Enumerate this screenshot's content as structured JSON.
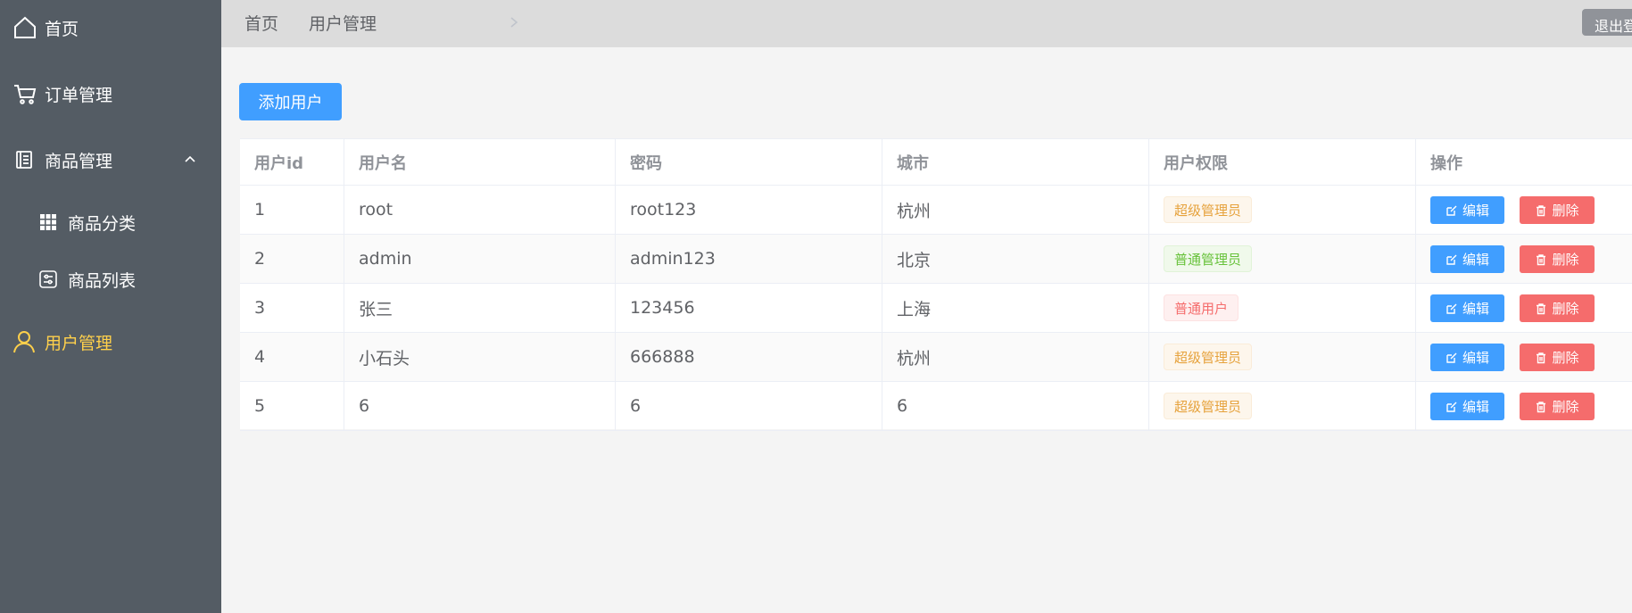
{
  "sidebar": {
    "items": [
      {
        "label": "首页",
        "icon": "home-icon"
      },
      {
        "label": "订单管理",
        "icon": "cart-icon"
      },
      {
        "label": "商品管理",
        "icon": "document-icon"
      },
      {
        "label": "商品分类",
        "icon": "grid-icon"
      },
      {
        "label": "商品列表",
        "icon": "list-icon"
      },
      {
        "label": "用户管理",
        "icon": "user-icon",
        "active": true
      }
    ]
  },
  "header": {
    "breadcrumb": [
      "首页",
      "用户管理"
    ],
    "logout_label": "退出登录"
  },
  "main": {
    "add_button_label": "添加用户",
    "table": {
      "columns": [
        "用户id",
        "用户名",
        "密码",
        "城市",
        "用户权限",
        "操作"
      ],
      "rows": [
        {
          "id": "1",
          "username": "root",
          "password": "root123",
          "city": "杭州",
          "role": "超级管理员",
          "role_type": "warning"
        },
        {
          "id": "2",
          "username": "admin",
          "password": "admin123",
          "city": "北京",
          "role": "普通管理员",
          "role_type": "success"
        },
        {
          "id": "3",
          "username": "张三",
          "password": "123456",
          "city": "上海",
          "role": "普通用户",
          "role_type": "danger"
        },
        {
          "id": "4",
          "username": "小石头",
          "password": "666888",
          "city": "杭州",
          "role": "超级管理员",
          "role_type": "warning"
        },
        {
          "id": "5",
          "username": "6",
          "password": "6",
          "city": "6",
          "role": "超级管理员",
          "role_type": "warning"
        }
      ],
      "edit_label": "编辑",
      "delete_label": "删除"
    }
  },
  "colors": {
    "sidebar_bg": "#545c64",
    "active": "#ffd04b",
    "primary": "#409eff",
    "danger": "#f56c6c"
  }
}
